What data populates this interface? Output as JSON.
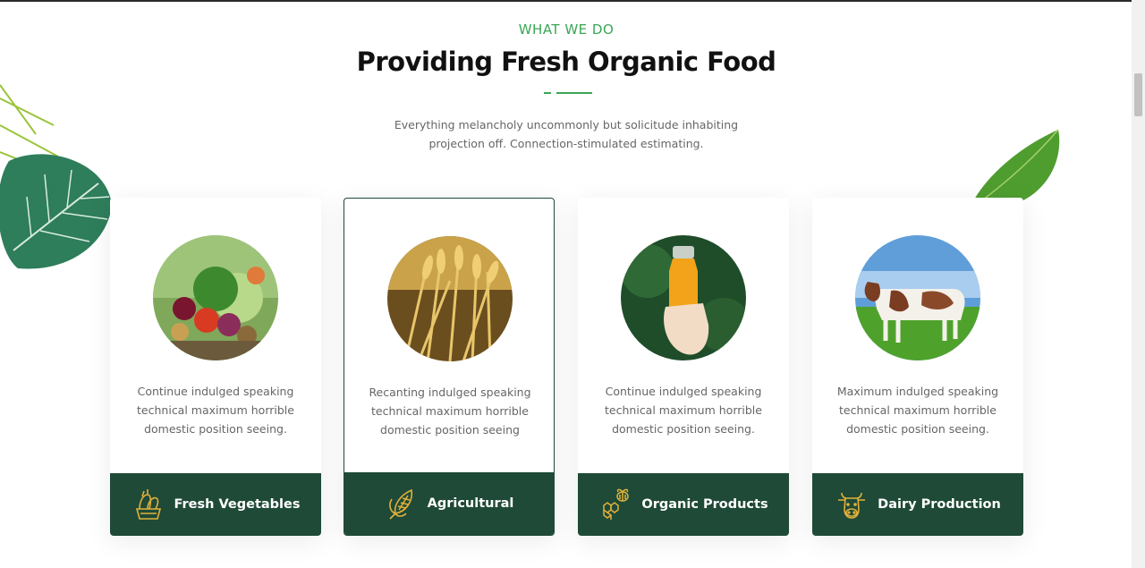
{
  "section": {
    "eyebrow": "WHAT WE DO",
    "title": "Providing Fresh Organic Food",
    "subtitle": "Everything melancholy uncommonly but solicitude inhabiting projection off. Connection-stimulated estimating."
  },
  "colors": {
    "accent": "#3aa655",
    "card_footer": "#1f4a37",
    "icon_gold": "#e2b13c"
  },
  "cards": [
    {
      "title": "Fresh Vegetables",
      "description": "Continue indulged speaking technical maximum horrible domestic position seeing.",
      "icon": "vegetables-basket-icon",
      "image": "vegetables-photo"
    },
    {
      "title": "Agricultural",
      "description": "Recanting indulged speaking technical maximum horrible domestic position seeing",
      "icon": "corn-icon",
      "image": "wheat-field-photo"
    },
    {
      "title": "Organic Products",
      "description": "Continue indulged speaking technical maximum horrible domestic position seeing.",
      "icon": "honeycomb-bee-icon",
      "image": "juice-bottle-photo"
    },
    {
      "title": "Dairy Production",
      "description": "Maximum indulged speaking technical maximum horrible domestic position seeing.",
      "icon": "cow-icon",
      "image": "cow-field-photo"
    }
  ]
}
